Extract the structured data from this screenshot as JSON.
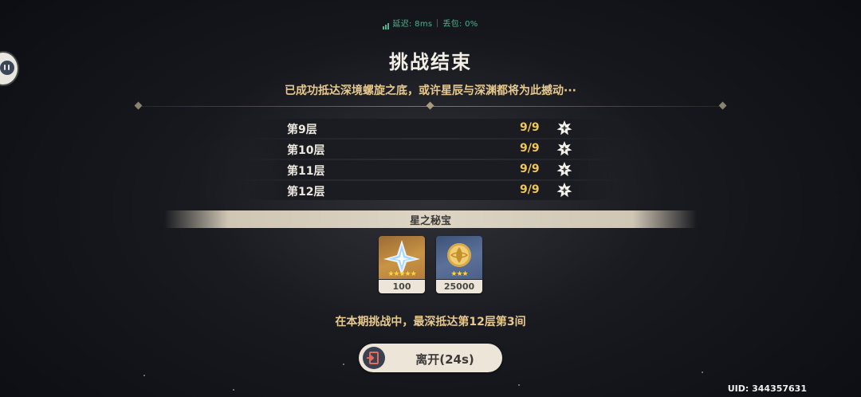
{
  "network": {
    "latency_label": "延迟: 8ms",
    "packet_loss_label": "丢包: 0%"
  },
  "header": {
    "title": "挑战结束",
    "subtitle": "已成功抵达深境螺旋之底，或许星辰与深渊都将为此撼动···"
  },
  "floors": [
    {
      "name": "第9层",
      "score": "9/9"
    },
    {
      "name": "第10层",
      "score": "9/9"
    },
    {
      "name": "第11层",
      "score": "9/9"
    },
    {
      "name": "第12层",
      "score": "9/9"
    }
  ],
  "rewards": {
    "section_label": "星之秘宝",
    "items": [
      {
        "icon": "primogem-icon",
        "rarity": 5,
        "count": "100"
      },
      {
        "icon": "mora-icon",
        "rarity": 3,
        "count": "25000"
      }
    ]
  },
  "deepest_text": "在本期挑战中，最深抵达第12层第3间",
  "leave_button": {
    "label": "离开(24s)"
  },
  "uid": "UID: 344357631",
  "colors": {
    "gold_text": "#e7c98d",
    "score": "#f0c65a",
    "network_ok": "#4fb38b",
    "button_bg": "#ece5d8"
  }
}
